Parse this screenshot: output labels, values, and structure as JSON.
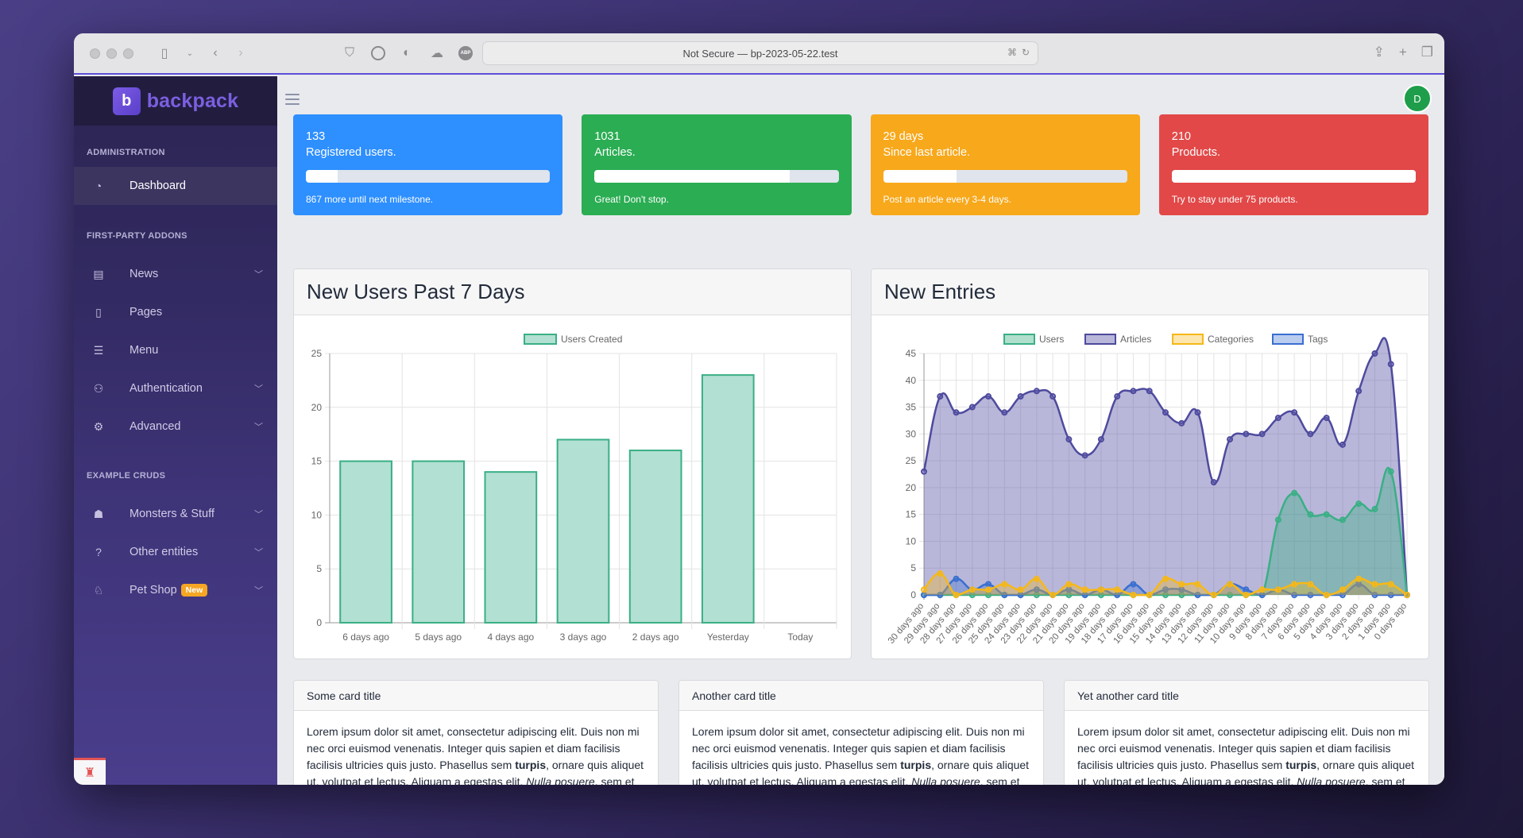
{
  "browser": {
    "url_text": "Not Secure — bp-2023-05-22.test",
    "extensions": [
      "pocket-icon",
      "1password-icon",
      "privacy-shield-icon",
      "cloud-icon",
      "adblock-icon"
    ],
    "adblock_label": "ABP"
  },
  "sidebar": {
    "brand": "backpack",
    "brand_logo_letter": "b",
    "sections": [
      {
        "title": "ADMINISTRATION",
        "items": [
          {
            "label": "Dashboard",
            "icon": "gauge-icon",
            "active": true,
            "expandable": false
          }
        ]
      },
      {
        "title": "FIRST-PARTY ADDONS",
        "items": [
          {
            "label": "News",
            "icon": "newspaper-icon",
            "expandable": true
          },
          {
            "label": "Pages",
            "icon": "file-icon",
            "expandable": false
          },
          {
            "label": "Menu",
            "icon": "list-icon",
            "expandable": false
          },
          {
            "label": "Authentication",
            "icon": "users-icon",
            "expandable": true
          },
          {
            "label": "Advanced",
            "icon": "cogs-icon",
            "expandable": true
          }
        ]
      },
      {
        "title": "EXAMPLE CRUDS",
        "items": [
          {
            "label": "Monsters & Stuff",
            "icon": "monster-icon",
            "expandable": true
          },
          {
            "label": "Other entities",
            "icon": "question-icon",
            "expandable": true
          },
          {
            "label": "Pet Shop",
            "icon": "dog-icon",
            "expandable": true,
            "badge": "New"
          }
        ]
      }
    ]
  },
  "header": {
    "avatar_initial": "D"
  },
  "stats": [
    {
      "value": "133",
      "label": "Registered users.",
      "progress": 0.13,
      "hint": "867 more until next milestone.",
      "color": "#2e8fff"
    },
    {
      "value": "1031",
      "label": "Articles.",
      "progress": 0.8,
      "hint": "Great! Don't stop.",
      "color": "#2bad53"
    },
    {
      "value": "29 days",
      "label": "Since last article.",
      "progress": 0.3,
      "hint": "Post an article every 3-4 days.",
      "color": "#f7a81b"
    },
    {
      "value": "210",
      "label": "Products.",
      "progress": 1.0,
      "hint": "Try to stay under 75 products.",
      "color": "#e24848"
    }
  ],
  "chart_data": [
    {
      "type": "bar",
      "title": "New Users Past 7 Days",
      "legend": [
        "Users Created"
      ],
      "legend_position": "top",
      "categories": [
        "6 days ago",
        "5 days ago",
        "4 days ago",
        "3 days ago",
        "2 days ago",
        "Yesterday",
        "Today"
      ],
      "series": [
        {
          "name": "Users Created",
          "values": [
            15,
            15,
            14,
            17,
            16,
            23,
            0
          ],
          "color": "#3aaf85",
          "fill": "#b2e0d2"
        }
      ],
      "ylim": [
        0,
        25
      ],
      "yticks": [
        0,
        5,
        10,
        15,
        20,
        25
      ],
      "grid": true,
      "xlabel": "",
      "ylabel": ""
    },
    {
      "type": "area",
      "title": "New Entries",
      "legend_position": "top",
      "categories": [
        "30 days ago",
        "29 days ago",
        "28 days ago",
        "27 days ago",
        "26 days ago",
        "25 days ago",
        "24 days ago",
        "23 days ago",
        "22 days ago",
        "21 days ago",
        "20 days ago",
        "19 days ago",
        "18 days ago",
        "17 days ago",
        "16 days ago",
        "15 days ago",
        "14 days ago",
        "13 days ago",
        "12 days ago",
        "11 days ago",
        "10 days ago",
        "9 days ago",
        "8 days ago",
        "7 days ago",
        "6 days ago",
        "5 days ago",
        "4 days ago",
        "3 days ago",
        "2 days ago",
        "1 days ago",
        "0 days ago"
      ],
      "series": [
        {
          "name": "Users",
          "color": "#3aaf85",
          "fill": "rgba(58,175,133,0.40)",
          "values": [
            0,
            0,
            0,
            0,
            0,
            0,
            0,
            0,
            0,
            0,
            0,
            0,
            0,
            0,
            0,
            0,
            0,
            0,
            0,
            0,
            0,
            0,
            14,
            19,
            15,
            15,
            14,
            17,
            16,
            23,
            0
          ]
        },
        {
          "name": "Articles",
          "color": "#4e4a9e",
          "fill": "rgba(100,95,170,0.45)",
          "values": [
            23,
            37,
            34,
            35,
            37,
            34,
            37,
            38,
            37,
            29,
            26,
            29,
            37,
            38,
            38,
            34,
            32,
            34,
            21,
            29,
            30,
            30,
            33,
            34,
            30,
            33,
            28,
            38,
            45,
            43,
            0
          ]
        },
        {
          "name": "Categories",
          "color": "#f6b818",
          "fill": "rgba(246,184,24,0.35)",
          "values": [
            1,
            4,
            0,
            1,
            1,
            2,
            1,
            3,
            0,
            2,
            1,
            1,
            1,
            0,
            0,
            3,
            2,
            2,
            0,
            2,
            0,
            1,
            1,
            2,
            2,
            0,
            1,
            3,
            2,
            2,
            0
          ]
        },
        {
          "name": "Tags",
          "color": "#3a6fd0",
          "fill": "rgba(58,111,208,0.35)",
          "values": [
            0,
            0,
            3,
            1,
            2,
            0,
            0,
            1,
            0,
            1,
            0,
            1,
            0,
            2,
            0,
            1,
            1,
            0,
            0,
            2,
            1,
            0,
            1,
            0,
            0,
            0,
            0,
            2,
            0,
            0,
            0
          ]
        }
      ],
      "ylim": [
        0,
        45
      ],
      "yticks": [
        0,
        5,
        10,
        15,
        20,
        25,
        30,
        35,
        40,
        45
      ],
      "grid": true,
      "xlabel": "",
      "ylabel": ""
    }
  ],
  "text_cards": [
    {
      "title": "Some card title"
    },
    {
      "title": "Another card title"
    },
    {
      "title": "Yet another card title"
    }
  ],
  "lorem": {
    "part1": "Lorem ipsum dolor sit amet, consectetur adipiscing elit. Duis non mi nec orci euismod venenatis. Integer quis sapien et diam facilisis facilisis ultricies quis justo. Phasellus sem ",
    "bold": "turpis",
    "part2": ", ornare quis aliquet ut, volutpat et lectus. Aliquam a egestas elit. ",
    "italic": "Nulla posuere",
    "part3": ", sem et porttitor mollis, massa nibh sagittis nibh, id porttitor nibh turpis sed arcu."
  }
}
